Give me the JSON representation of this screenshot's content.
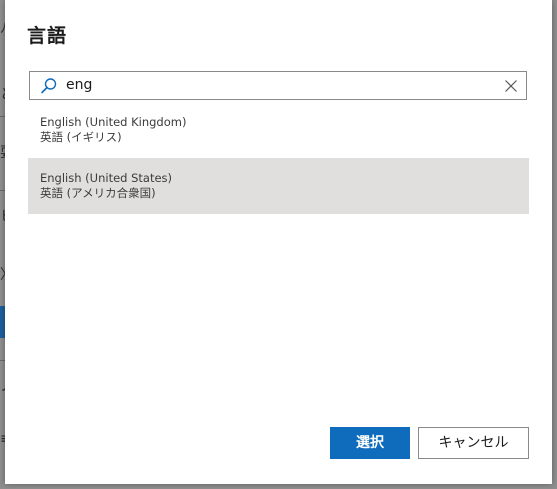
{
  "dialog": {
    "title": "言語"
  },
  "search": {
    "value": "eng",
    "placeholder": ""
  },
  "results": [
    {
      "name": "English (United Kingdom)",
      "localized": "英語 (イギリス)",
      "selected": false
    },
    {
      "name": "English (United States)",
      "localized": "英語 (アメリカ合衆国)",
      "selected": true
    }
  ],
  "buttons": {
    "select_label": "選択",
    "cancel_label": "キャンセル"
  },
  "background_fragments": [
    "ﾉ",
    "と",
    "耍",
    "ヒ",
    "ノ",
    "〉",
    "≡"
  ],
  "colors": {
    "primary": "#0f6cbd",
    "selected_row": "#e0dfde",
    "backdrop": "#8f8f8f"
  },
  "icons": {
    "search": "search-icon",
    "clear": "close-icon"
  }
}
